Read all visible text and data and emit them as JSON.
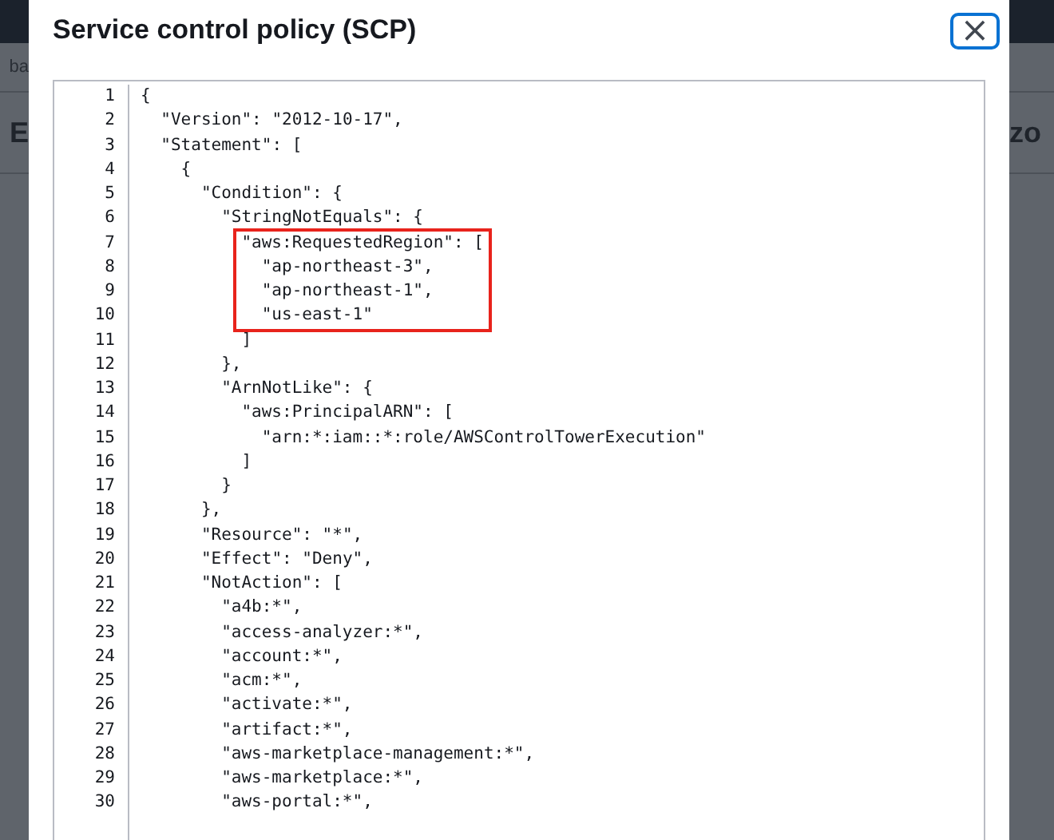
{
  "background": {
    "left_texts": [
      "ba",
      "E"
    ],
    "right_texts": [
      "zo"
    ]
  },
  "modal": {
    "title": "Service control policy (SCP)",
    "close_label": "×"
  },
  "code": {
    "lines": [
      {
        "number": "1",
        "text": "{",
        "highlighted": false
      },
      {
        "number": "2",
        "text": "  \"Version\": \"2012-10-17\",",
        "highlighted": false
      },
      {
        "number": "3",
        "text": "  \"Statement\": [",
        "highlighted": false
      },
      {
        "number": "4",
        "text": "    {",
        "highlighted": false
      },
      {
        "number": "5",
        "text": "      \"Condition\": {",
        "highlighted": false
      },
      {
        "number": "6",
        "text": "        \"StringNotEquals\": {",
        "highlighted": false
      },
      {
        "number": "7",
        "text": "          \"aws:RequestedRegion\": [",
        "highlighted": true
      },
      {
        "number": "8",
        "text": "            \"ap-northeast-3\",",
        "highlighted": true
      },
      {
        "number": "9",
        "text": "            \"ap-northeast-1\",",
        "highlighted": true
      },
      {
        "number": "10",
        "text": "            \"us-east-1\"",
        "highlighted": true
      },
      {
        "number": "11",
        "text": "          ]",
        "highlighted": false
      },
      {
        "number": "12",
        "text": "        },",
        "highlighted": false
      },
      {
        "number": "13",
        "text": "        \"ArnNotLike\": {",
        "highlighted": false
      },
      {
        "number": "14",
        "text": "          \"aws:PrincipalARN\": [",
        "highlighted": false
      },
      {
        "number": "15",
        "text": "            \"arn:*:iam::*:role/AWSControlTowerExecution\"",
        "highlighted": false
      },
      {
        "number": "16",
        "text": "          ]",
        "highlighted": false
      },
      {
        "number": "17",
        "text": "        }",
        "highlighted": false
      },
      {
        "number": "18",
        "text": "      },",
        "highlighted": false
      },
      {
        "number": "19",
        "text": "      \"Resource\": \"*\",",
        "highlighted": false
      },
      {
        "number": "20",
        "text": "      \"Effect\": \"Deny\",",
        "highlighted": false
      },
      {
        "number": "21",
        "text": "      \"NotAction\": [",
        "highlighted": false
      },
      {
        "number": "22",
        "text": "        \"a4b:*\",",
        "highlighted": false
      },
      {
        "number": "23",
        "text": "        \"access-analyzer:*\",",
        "highlighted": false
      },
      {
        "number": "24",
        "text": "        \"account:*\",",
        "highlighted": false
      },
      {
        "number": "25",
        "text": "        \"acm:*\",",
        "highlighted": false
      },
      {
        "number": "26",
        "text": "        \"activate:*\",",
        "highlighted": false
      },
      {
        "number": "27",
        "text": "        \"artifact:*\",",
        "highlighted": false
      },
      {
        "number": "28",
        "text": "        \"aws-marketplace-management:*\",",
        "highlighted": false
      },
      {
        "number": "29",
        "text": "        \"aws-marketplace:*\",",
        "highlighted": false
      },
      {
        "number": "30",
        "text": "        \"aws-portal:*\",",
        "highlighted": false
      }
    ]
  }
}
